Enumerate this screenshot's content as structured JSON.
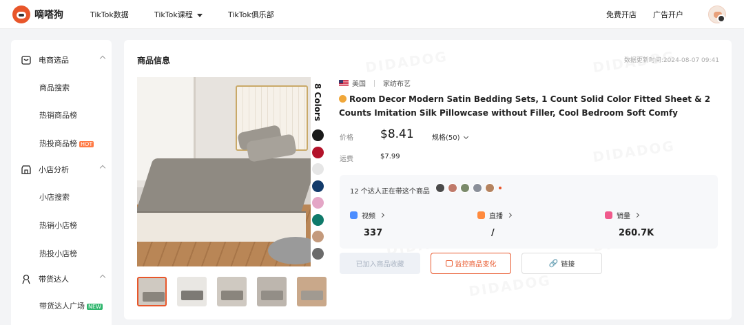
{
  "header": {
    "logo_text": "嘀嗒狗",
    "nav": [
      "TikTok数据",
      "TikTok课程",
      "TikTok俱乐部"
    ],
    "right_links": [
      "免费开店",
      "广告开户"
    ]
  },
  "sidebar": {
    "sections": [
      {
        "label": "电商选品",
        "items": [
          "商品搜索",
          "热销商品榜",
          "热投商品榜"
        ]
      },
      {
        "label": "小店分析",
        "items": [
          "小店搜索",
          "热销小店榜",
          "热投小店榜"
        ]
      },
      {
        "label": "带货达人",
        "items": [
          "带货达人广场"
        ]
      }
    ],
    "hot_badge": "HOT",
    "new_badge": "NEW"
  },
  "main": {
    "title": "商品信息",
    "update_time": "数据更新时间:2024-08-07 09:41",
    "watermark": "DIDADOG",
    "colors_label": "8 Colors",
    "swatches": [
      "#1a1a1a",
      "#b3122a",
      "#e6e6e6",
      "#133b6b",
      "#e4a6c6",
      "#0f7a6a",
      "#c49a7c",
      "#6b6b6b"
    ],
    "country": "美国",
    "category": "家纺布艺",
    "product_title": "Room Decor Modern Satin Bedding Sets, 1 Count Solid Color Fitted Sheet & 2 Counts Imitation Silk Pillowcase without Filler, Cool Bedroom Soft Comfy Bedding Set, Back t...",
    "price_label": "价格",
    "price": "$8.41",
    "spec": "规格(50)",
    "shipping_label": "运费",
    "shipping": "$7.99",
    "influencer_text": "12 个达人正在带这个商品",
    "stats": [
      {
        "label": "视频",
        "value": "337"
      },
      {
        "label": "直播",
        "value": "/"
      },
      {
        "label": "销量",
        "value": "260.7K"
      }
    ],
    "buttons": {
      "added": "已加入商品收藏",
      "monitor": "监控商品变化",
      "link": "链接"
    }
  }
}
